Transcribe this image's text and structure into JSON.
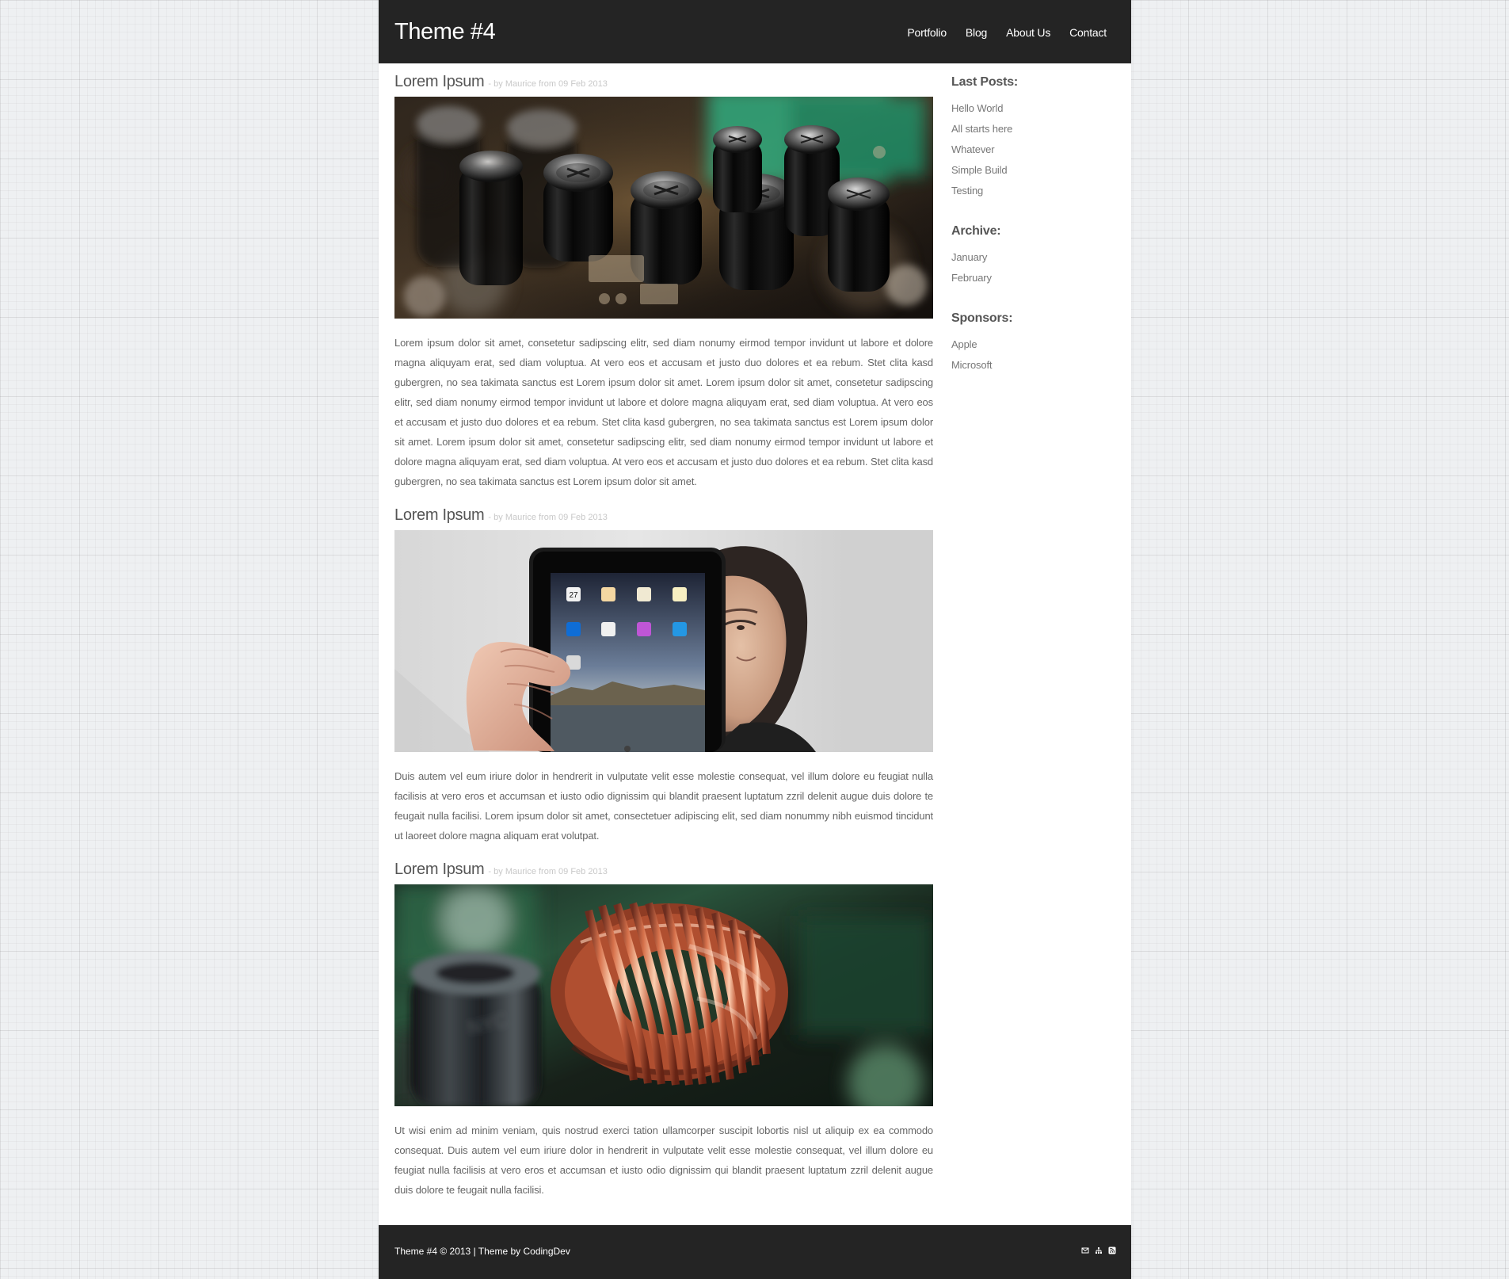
{
  "site": {
    "title": "Theme #4"
  },
  "nav": {
    "items": [
      {
        "label": "Portfolio"
      },
      {
        "label": "Blog"
      },
      {
        "label": "About Us"
      },
      {
        "label": "Contact"
      }
    ]
  },
  "posts": [
    {
      "title": "Lorem Ipsum",
      "meta": "- by Maurice from 09 Feb 2013",
      "image": "circuit-board-capacitors-image",
      "body": "Lorem ipsum dolor sit amet, consetetur sadipscing elitr, sed diam nonumy eirmod tempor invidunt ut labore et dolore magna aliquyam erat, sed diam voluptua. At vero eos et accusam et justo duo dolores et ea rebum. Stet clita kasd gubergren, no sea takimata sanctus est Lorem ipsum dolor sit amet. Lorem ipsum dolor sit amet, consetetur sadipscing elitr, sed diam nonumy eirmod tempor invidunt ut labore et dolore magna aliquyam erat, sed diam voluptua. At vero eos et accusam et justo duo dolores et ea rebum. Stet clita kasd gubergren, no sea takimata sanctus est Lorem ipsum dolor sit amet. Lorem ipsum dolor sit amet, consetetur sadipscing elitr, sed diam nonumy eirmod tempor invidunt ut labore et dolore magna aliquyam erat, sed diam voluptua. At vero eos et accusam et justo duo dolores et ea rebum. Stet clita kasd gubergren, no sea takimata sanctus est Lorem ipsum dolor sit amet."
    },
    {
      "title": "Lorem Ipsum",
      "meta": "- by Maurice from 09 Feb 2013",
      "image": "person-holding-tablet-image",
      "body": "Duis autem vel eum iriure dolor in hendrerit in vulputate velit esse molestie consequat, vel illum dolore eu feugiat nulla facilisis at vero eros et accumsan et iusto odio dignissim qui blandit praesent luptatum zzril delenit augue duis dolore te feugait nulla facilisi. Lorem ipsum dolor sit amet, consectetuer adipiscing elit, sed diam nonummy nibh euismod tincidunt ut laoreet dolore magna aliquam erat volutpat."
    },
    {
      "title": "Lorem Ipsum",
      "meta": "- by Maurice from 09 Feb 2013",
      "image": "copper-coil-inductor-image",
      "body": "Ut wisi enim ad minim veniam, quis nostrud exerci tation ullamcorper suscipit lobortis nisl ut aliquip ex ea commodo consequat. Duis autem vel eum iriure dolor in hendrerit in vulputate velit esse molestie consequat, vel illum dolore eu feugiat nulla facilisis at vero eros et accumsan et iusto odio dignissim qui blandit praesent luptatum zzril delenit augue duis dolore te feugait nulla facilisi."
    }
  ],
  "sidebar": {
    "sections": [
      {
        "heading": "Last Posts:",
        "links": [
          "Hello World",
          "All starts here",
          "Whatever",
          "Simple Build",
          "Testing"
        ]
      },
      {
        "heading": "Archive:",
        "links": [
          "January",
          "February"
        ]
      },
      {
        "heading": "Sponsors:",
        "links": [
          "Apple",
          "Microsoft"
        ]
      }
    ]
  },
  "footer": {
    "text": "Theme #4 © 2013 | Theme by CodingDev",
    "icons": [
      "mail-icon",
      "sitemap-icon",
      "rss-icon"
    ]
  },
  "colors": {
    "header_bg": "#242424",
    "page_bg": "#ffffff",
    "grid_bg": "#eef0f2",
    "text": "#666666",
    "meta": "#c8c8c8"
  }
}
